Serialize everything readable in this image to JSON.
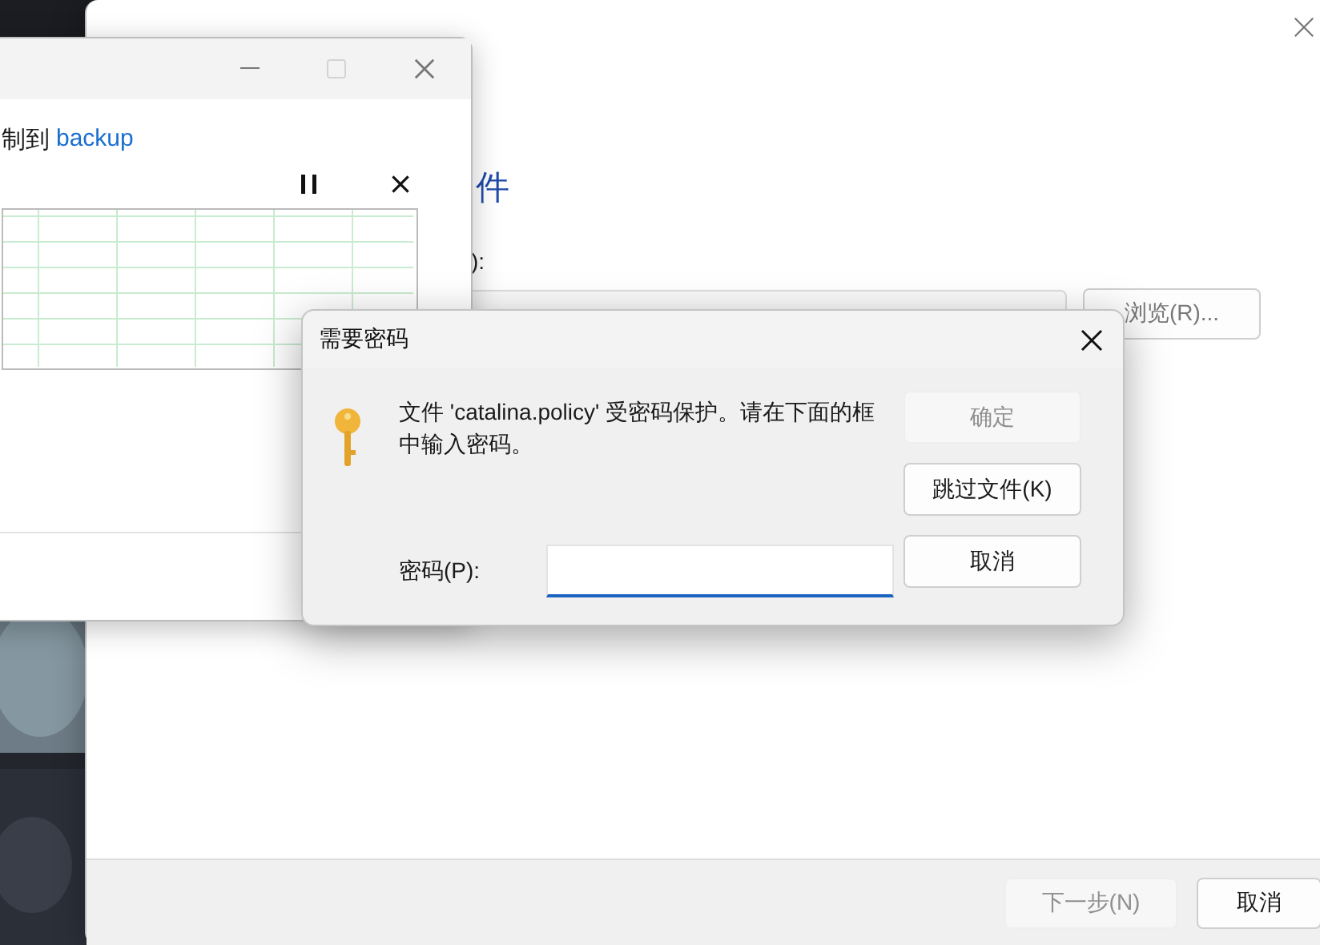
{
  "wizard": {
    "heading": "件",
    "field_label": "):",
    "browse_button": {
      "label": "浏览(R)...",
      "disabled": false
    },
    "buttons": [
      {
        "label": "下一步(N)",
        "disabled": true
      },
      {
        "label": "取消",
        "disabled": false
      }
    ]
  },
  "progress_window": {
    "status_prefix": "制到",
    "destination": "backup",
    "maximize_disabled": true
  },
  "password_dialog": {
    "title": "需要密码",
    "message": "文件 'catalina.policy' 受密码保护。请在下面的框中输入密码。",
    "password_label": "密码(P):",
    "buttons": [
      {
        "label": "确定",
        "disabled": true
      },
      {
        "label": "跳过文件(K)",
        "disabled": false
      },
      {
        "label": "取消",
        "disabled": false
      }
    ]
  }
}
